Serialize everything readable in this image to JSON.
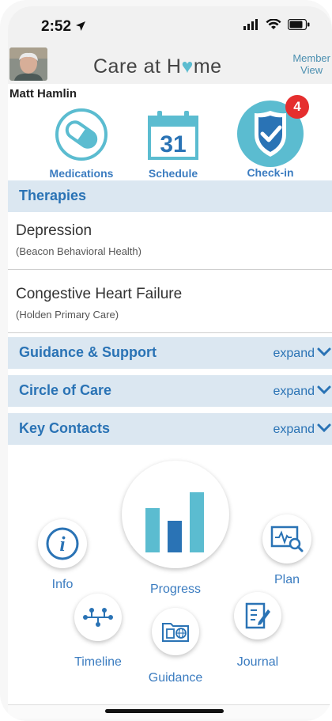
{
  "status": {
    "time": "2:52"
  },
  "header": {
    "brand_left": "Care at H",
    "brand_right": "me",
    "member_view_l1": "Member",
    "member_view_l2": "View"
  },
  "user": {
    "name": "Matt Hamlin"
  },
  "nav": {
    "medications": "Medications",
    "schedule": "Schedule",
    "schedule_day": "31",
    "checkin": "Check-in",
    "checkin_badge": "4"
  },
  "therapies": {
    "title": "Therapies",
    "items": [
      {
        "name": "Depression",
        "provider": "(Beacon Behavioral Health)"
      },
      {
        "name": "Congestive Heart Failure",
        "provider": "(Holden Primary Care)"
      }
    ]
  },
  "sections": [
    {
      "label": "Guidance & Support",
      "action": "expand"
    },
    {
      "label": "Circle of Care",
      "action": "expand"
    },
    {
      "label": "Key Contacts",
      "action": "expand"
    }
  ],
  "hub": {
    "info": "Info",
    "progress": "Progress",
    "plan": "Plan",
    "timeline": "Timeline",
    "guidance": "Guidance",
    "journal": "Journal"
  },
  "colors": {
    "accent": "#3b7cc0",
    "teal": "#5bbcd0",
    "badge": "#e52e2e",
    "section_bg": "#dbe7f1"
  }
}
